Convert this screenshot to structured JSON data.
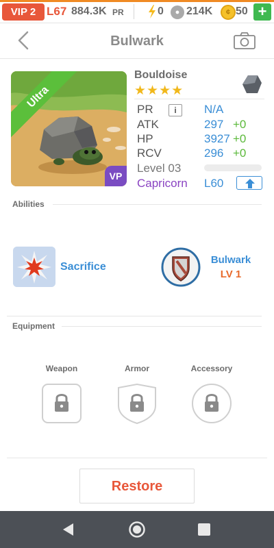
{
  "status_bar": {
    "vip": "VIP 2",
    "level": "L67",
    "power": "884.3K",
    "power_unit": "PR",
    "energy": "0",
    "paws": "214K",
    "coins": "50",
    "add": "+",
    "accent_color": "#f08a24"
  },
  "header": {
    "title": "Bulwark",
    "back_icon": "chevron-left-icon",
    "camera_icon": "camera-icon"
  },
  "monster": {
    "name": "Bouldoise",
    "stars": "★★★★",
    "rarity": "Ultra",
    "badge": "VP",
    "element_icon": "rock-icon",
    "stats": {
      "pr_label": "PR",
      "info_label": "i",
      "pr_value": "N/A",
      "atk_label": "ATK",
      "atk_value": "297",
      "atk_gain": "+0",
      "hp_label": "HP",
      "hp_value": "3927",
      "hp_gain": "+0",
      "rcv_label": "RCV",
      "rcv_value": "296",
      "rcv_gain": "+0",
      "level_label": "Level 03",
      "level_progress": 0,
      "sign": "Capricorn",
      "sign_level": "L60"
    }
  },
  "abilities": {
    "title": "Abilities",
    "ability_name": "Sacrifice",
    "skill_name": "Bulwark",
    "skill_level": "LV 1"
  },
  "equipment": {
    "title": "Equipment",
    "slots": [
      {
        "label": "Weapon"
      },
      {
        "label": "Armor"
      },
      {
        "label": "Accessory"
      }
    ]
  },
  "actions": {
    "restore": "Restore"
  },
  "colors": {
    "brand_orange": "#e8573a",
    "link_blue": "#3a8ed6",
    "gain_green": "#5bb93a",
    "sign_purple": "#8a43c2",
    "rarity_green": "#5bbf3b",
    "star_gold": "#f1b81b"
  }
}
